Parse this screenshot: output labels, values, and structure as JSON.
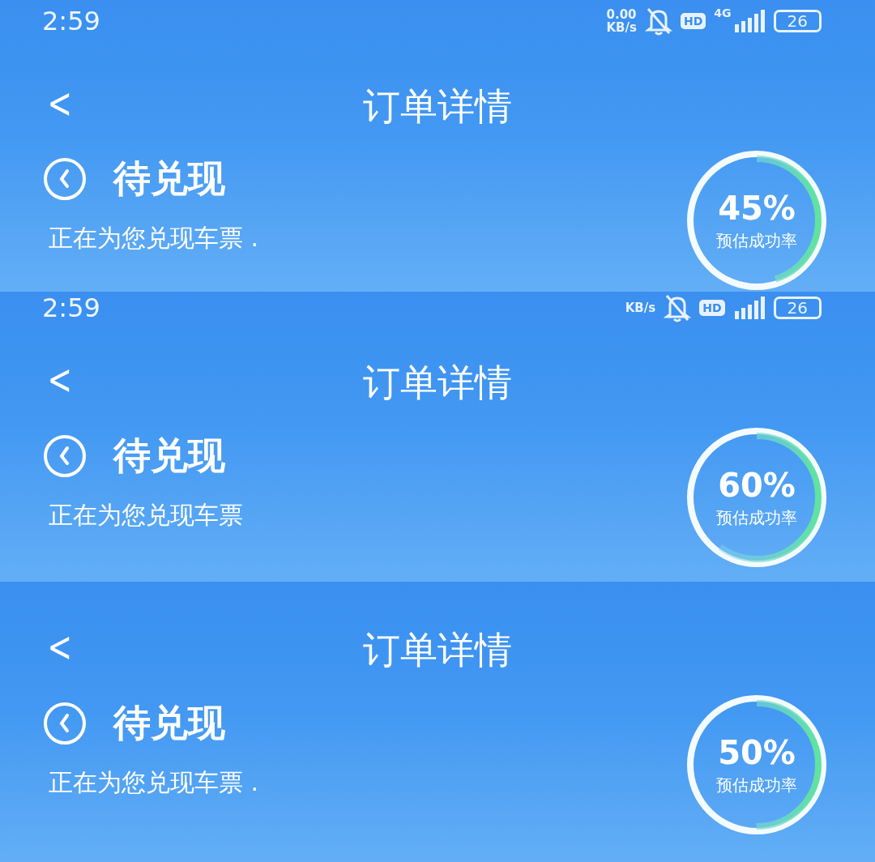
{
  "panels": [
    {
      "status_bar": {
        "time": "2:59",
        "speed_value": "0.00",
        "speed_unit": "KB/s",
        "hd": "HD",
        "network": "4G",
        "battery": "26"
      },
      "back": "<",
      "title": "订单详情",
      "order_status": "待兑现",
      "message": "正在为您兑现车票 .",
      "rate": "45%",
      "rate_label": "预估成功率",
      "level": 0.45
    },
    {
      "status_bar": {
        "time": "2:59",
        "speed_unit": "KB/s",
        "hd": "HD",
        "battery": "26"
      },
      "back": "<",
      "title": "订单详情",
      "order_status": "待兑现",
      "message": "正在为您兑现车票",
      "rate": "60%",
      "rate_label": "预估成功率",
      "level": 0.6
    },
    {
      "back": "<",
      "title": "订单详情",
      "order_status": "待兑现",
      "message": "正在为您兑现车票 .",
      "rate": "50%",
      "rate_label": "预估成功率",
      "level": 0.5
    }
  ]
}
